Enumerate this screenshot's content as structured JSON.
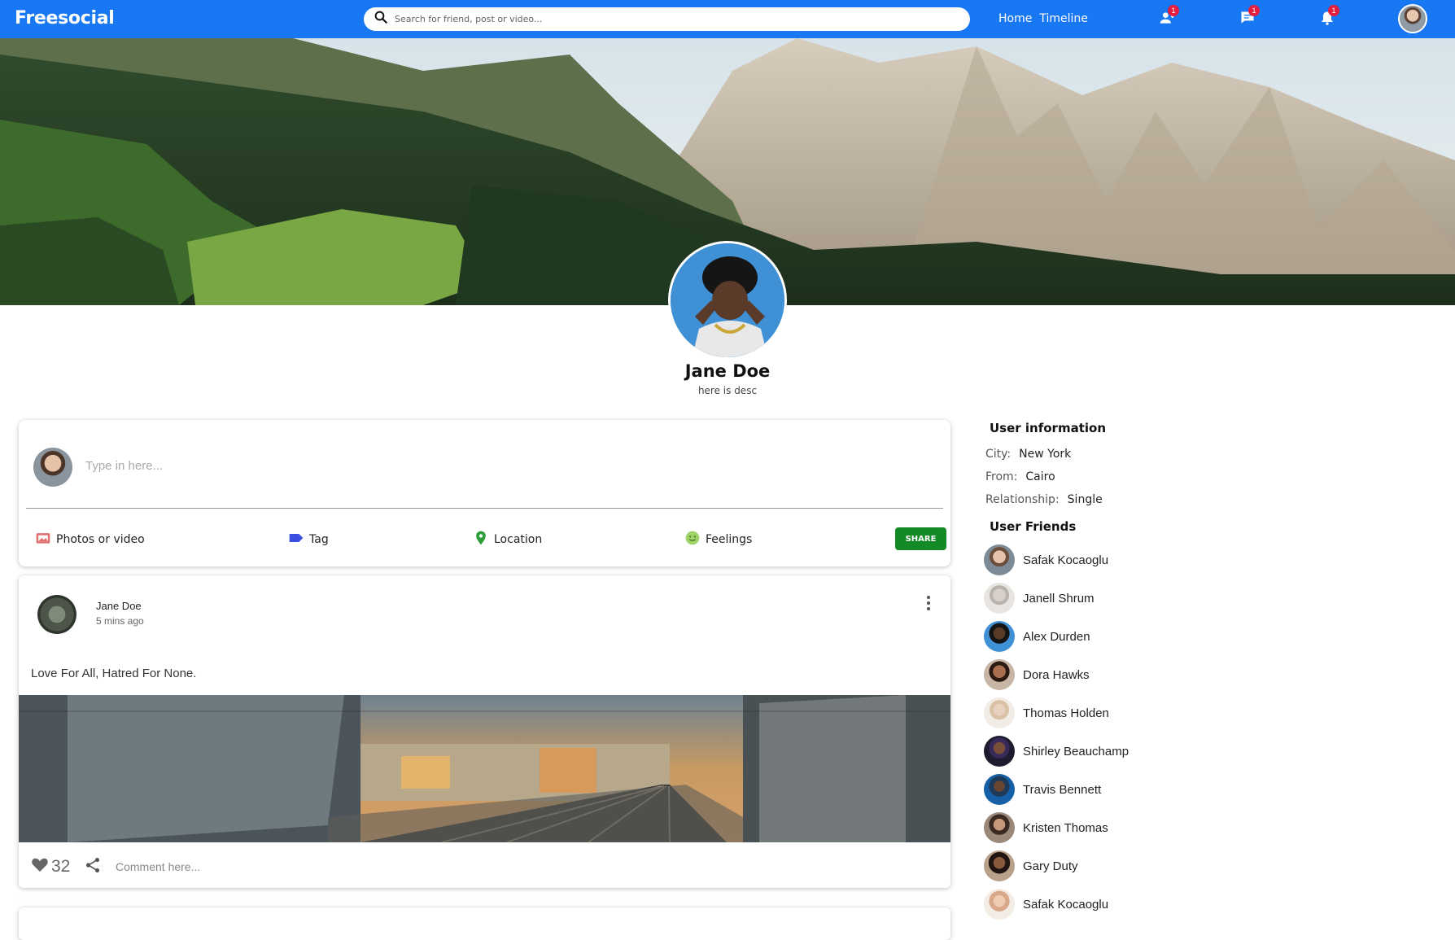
{
  "header": {
    "logo": "Freesocial",
    "search_placeholder": "Search for friend, post or video...",
    "nav": [
      "Home",
      "Timeline"
    ],
    "badges": {
      "friends": "1",
      "messages": "1",
      "notifications": "1"
    },
    "icons": [
      "search-icon",
      "person-icon",
      "chat-icon",
      "bell-icon"
    ]
  },
  "profile": {
    "name": "Jane Doe",
    "desc": "here is desc"
  },
  "composer": {
    "placeholder": "Type in here...",
    "options": {
      "photos": "Photos or video",
      "tag": "Tag",
      "location": "Location",
      "feelings": "Feelings"
    },
    "share": "SHARE"
  },
  "post": {
    "author": "Jane Doe",
    "time": "5 mins ago",
    "text": "Love For All, Hatred For None.",
    "likes": "32",
    "comment_placeholder": "Comment here..."
  },
  "sidebar": {
    "info_title": "User information",
    "info": [
      {
        "key": "City:",
        "value": "New York"
      },
      {
        "key": "From:",
        "value": "Cairo"
      },
      {
        "key": "Relationship:",
        "value": "Single"
      }
    ],
    "friends_title": "User Friends",
    "friends": [
      "Safak Kocaoglu",
      "Janell Shrum",
      "Alex Durden",
      "Dora Hawks",
      "Thomas Holden",
      "Shirley Beauchamp",
      "Travis Bennett",
      "Kristen Thomas",
      "Gary Duty",
      "Safak Kocaoglu"
    ]
  },
  "colors": {
    "brand": "#1877f2",
    "share_button": "#138a26",
    "badge": "#e41e3f"
  }
}
